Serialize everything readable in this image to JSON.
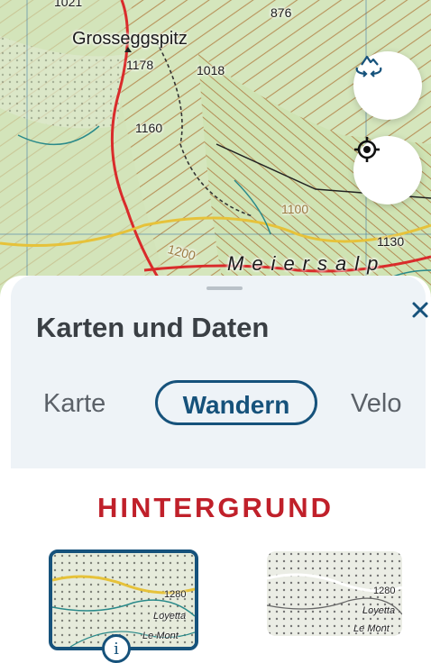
{
  "map": {
    "peak_name": "Grosseggspitz",
    "altitudes": {
      "a1178": "1178",
      "a1018": "1018",
      "a1160": "1160",
      "a876": "876",
      "a1021": "1021",
      "a1130": "1130",
      "a1100": "1100",
      "a1200": "1200"
    },
    "region": "Meiersalp",
    "fab_terrain_icon": "mountain-3d-rotate-icon",
    "fab_locate_icon": "crosshair-location-icon"
  },
  "sheet": {
    "title": "Karten und Daten",
    "close_icon": "close-icon",
    "tabs": [
      {
        "label": "Karte",
        "active": false
      },
      {
        "label": "Wandern",
        "active": true
      },
      {
        "label": "Velo",
        "active": false
      }
    ],
    "section_title": "HINTERGRUND",
    "thumbnails": {
      "color_label_a": "1280",
      "color_label_b": "Loyetta",
      "color_label_c": "Le Mont",
      "bw_label_a": "1280",
      "bw_label_b": "Loyetta",
      "bw_label_c": "Le Mont"
    },
    "info_glyph": "i"
  },
  "colors": {
    "accent_blue": "#16527b",
    "section_red": "#c0202a",
    "route_red": "#d92b2b",
    "road_yellow": "#e6c23a"
  }
}
